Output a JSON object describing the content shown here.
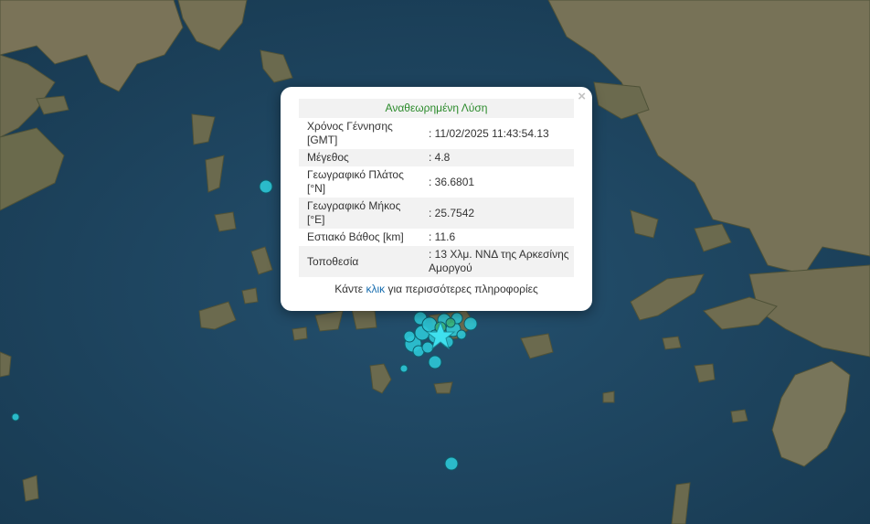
{
  "popup": {
    "close_glyph": "×",
    "title": "Αναθεωρημένη Λύση",
    "rows": [
      {
        "label": "Χρόνος Γέννησης [GMT]",
        "value": ": 11/02/2025 11:43:54.13"
      },
      {
        "label": "Μέγεθος",
        "value": ": 4.8"
      },
      {
        "label": "Γεωγραφικό Πλάτος [°N]",
        "value": ": 36.6801"
      },
      {
        "label": "Γεωγραφικό Μήκος [°E]",
        "value": ": 25.7542"
      },
      {
        "label": "Εστιακό Βάθος [km]",
        "value": ": 11.6"
      },
      {
        "label": "Τοποθεσία",
        "value": ": 13 Χλμ. ΝΝΔ της Αρκεσίνης Αμοργού"
      }
    ],
    "footer_prefix": "Κάντε",
    "footer_link": "κλικ",
    "footer_suffix": "για περισσότερες πληροφορίες"
  },
  "colors": {
    "sea": "#1e4561",
    "land": "#6b6a4e",
    "marker_fill": "#2cc6d6",
    "marker_stroke": "#0e5d6a",
    "star": "#3fe0ee",
    "title_green": "#2a8a2a",
    "link_blue": "#1a6fb0"
  },
  "icons": {
    "close": "close-icon",
    "epicenter": "star-icon"
  }
}
